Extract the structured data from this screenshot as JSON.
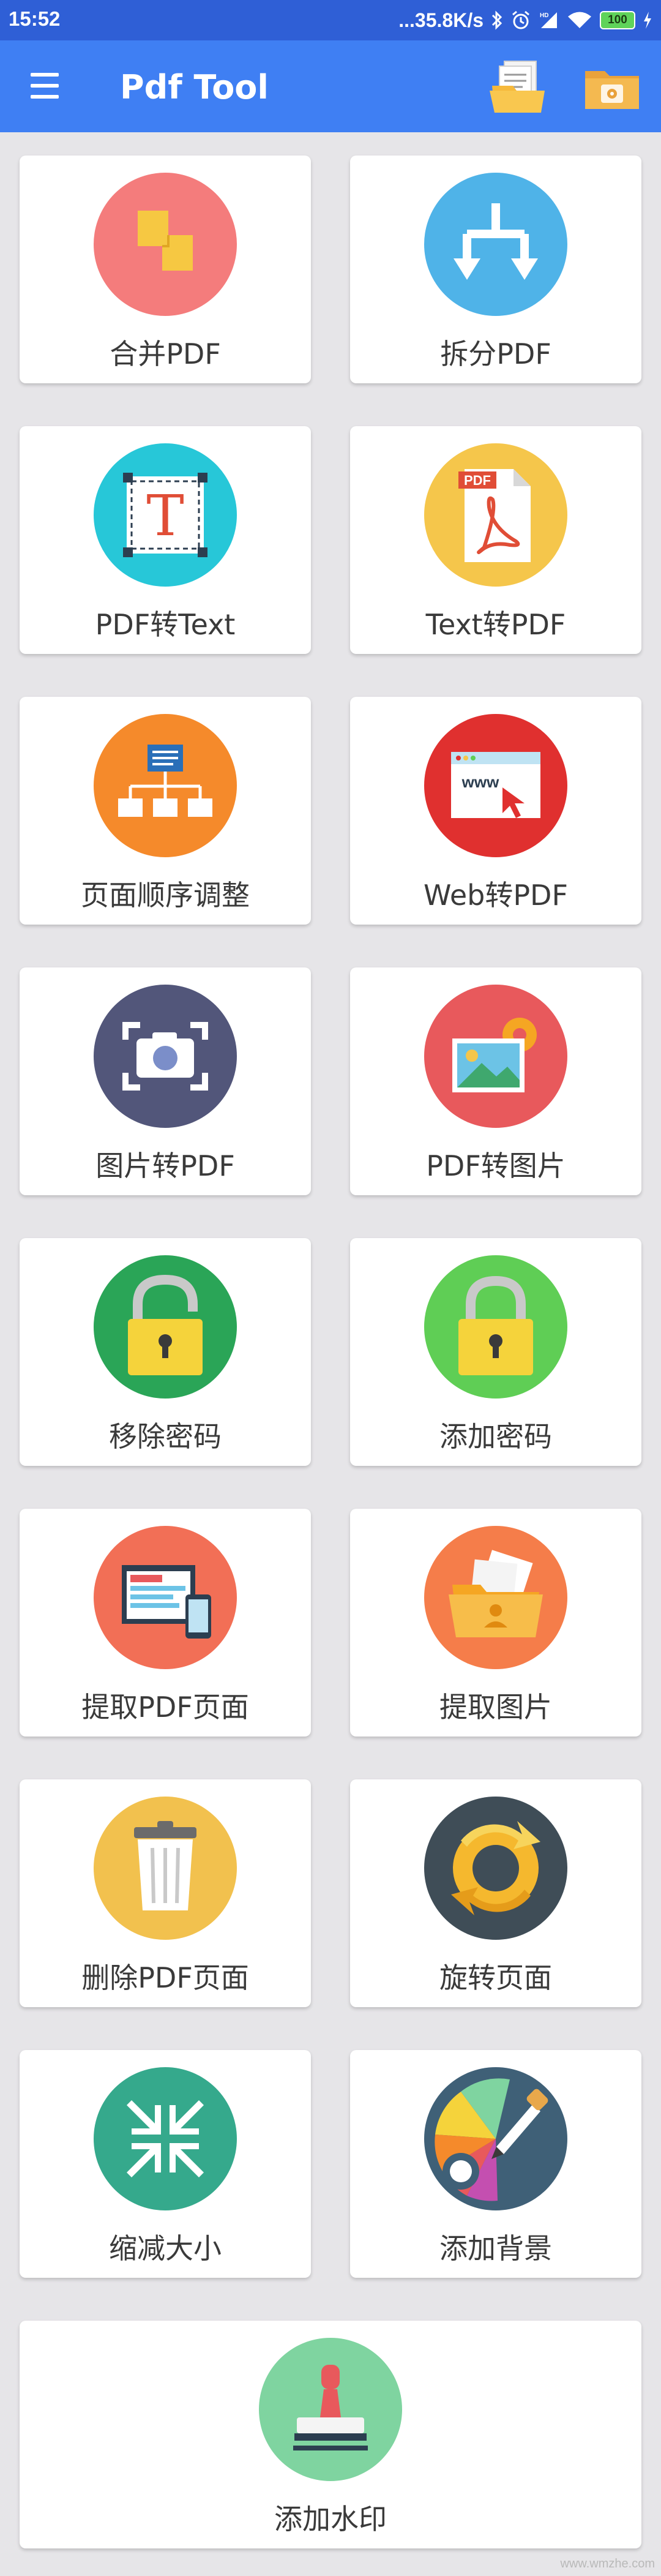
{
  "status_bar": {
    "time": "15:52",
    "network_speed": "...35.8K/s",
    "battery": "100"
  },
  "app_bar": {
    "title": "Pdf Tool"
  },
  "tools": [
    {
      "label": "合并PDF",
      "icon": "merge-icon",
      "color": "#f47c7c"
    },
    {
      "label": "拆分PDF",
      "icon": "split-icon",
      "color": "#4fb3e8"
    },
    {
      "label": "PDF转Text",
      "icon": "text-icon",
      "color": "#27c7d8"
    },
    {
      "label": "Text转PDF",
      "icon": "pdf-file-icon",
      "color": "#f5c64b"
    },
    {
      "label": "页面顺序调整",
      "icon": "sitemap-icon",
      "color": "#f58a2b"
    },
    {
      "label": "Web转PDF",
      "icon": "web-browser-icon",
      "color": "#e0302f"
    },
    {
      "label": "图片转PDF",
      "icon": "camera-icon",
      "color": "#52567a"
    },
    {
      "label": "PDF转图片",
      "icon": "image-settings-icon",
      "color": "#e8595c"
    },
    {
      "label": "移除密码",
      "icon": "unlock-icon",
      "color": "#2aa557"
    },
    {
      "label": "添加密码",
      "icon": "lock-icon",
      "color": "#5fce55"
    },
    {
      "label": "提取PDF页面",
      "icon": "extract-pages-icon",
      "color": "#f26f56"
    },
    {
      "label": "提取图片",
      "icon": "extract-images-icon",
      "color": "#f57d4a"
    },
    {
      "label": "删除PDF页面",
      "icon": "trash-icon",
      "color": "#f2c14e"
    },
    {
      "label": "旋转页面",
      "icon": "rotate-icon",
      "color": "#3f4d57"
    },
    {
      "label": "缩减大小",
      "icon": "compress-icon",
      "color": "#35a98c"
    },
    {
      "label": "添加背景",
      "icon": "palette-icon",
      "color": "#3f6077"
    },
    {
      "label": "添加水印",
      "icon": "stamp-icon",
      "color": "#7fd4a0"
    }
  ],
  "watermark": "www.wmzhe.com"
}
